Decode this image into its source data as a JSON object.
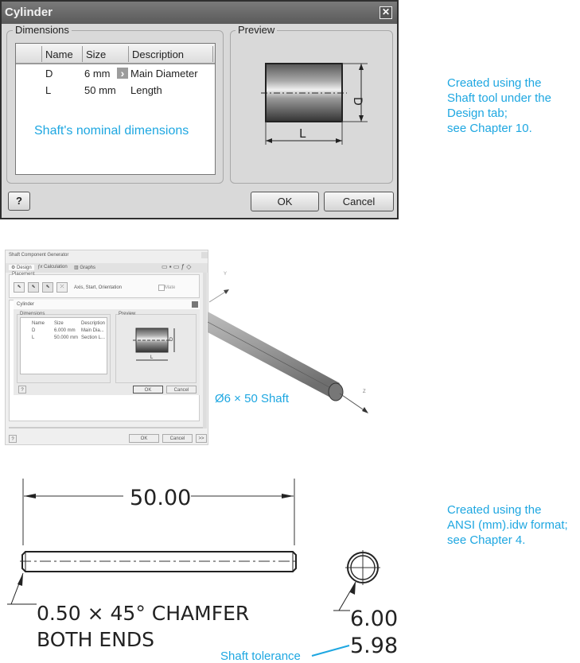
{
  "cylinder_dialog": {
    "title": "Cylinder",
    "close_label": "✕",
    "dimensions_group": "Dimensions",
    "preview_group": "Preview",
    "columns": [
      "Name",
      "Size",
      "Description"
    ],
    "rows": [
      {
        "name": "D",
        "size": "6 mm",
        "description": "Main Diameter",
        "has_arrow": true
      },
      {
        "name": "L",
        "size": "50 mm",
        "description": "Length",
        "has_arrow": false
      }
    ],
    "arrow_glyph": "›",
    "annotation": "Shaft's nominal dimensions",
    "preview_labels": {
      "length": "L",
      "diameter": "D"
    },
    "help_label": "?",
    "ok_label": "OK",
    "cancel_label": "Cancel"
  },
  "callout_top": [
    "Created using the",
    "Shaft tool under the",
    "Design tab;",
    "see Chapter 10."
  ],
  "shaft_generator": {
    "title": "Shaft Component Generator",
    "tabs": [
      "Design",
      "Calculation",
      "Graphs"
    ],
    "placement_label": "Placement",
    "placement_text": "Axis, Start, Orientation",
    "mate_label": "Mate",
    "cylinder_title": "Cylinder",
    "dimensions_group": "Dimensions",
    "preview_group": "Preview",
    "columns": [
      "Name",
      "Size",
      "Description"
    ],
    "rows": [
      {
        "name": "D",
        "size": "6.000 mm",
        "description": "Main Dia..."
      },
      {
        "name": "L",
        "size": "50.000 mm",
        "description": "Section L..."
      }
    ],
    "preview_labels": {
      "length": "L",
      "diameter": "D"
    },
    "inner_ok": "OK",
    "inner_cancel": "Cancel",
    "ok_label": "OK",
    "cancel_label": "Cancel",
    "more_label": ">>",
    "help_label": "?"
  },
  "model_view": {
    "axis_y": "Y",
    "axis_z": "Z",
    "shaft_label": "Ø6 × 50 Shaft"
  },
  "drawing": {
    "length_dim": "50.00",
    "chamfer_note_line1": "0.50 × 45° CHAMFER",
    "chamfer_note_line2": "BOTH ENDS",
    "diameter_upper": "6.00",
    "diameter_lower": "5.98",
    "tolerance_label": "Shaft tolerance"
  },
  "callout_bottom": [
    "Created using the",
    "ANSI (mm).idw format;",
    "see Chapter 4."
  ],
  "colors": {
    "accent": "#1ea7e1",
    "dialog_bg": "#d9d9d9",
    "titlebar": "#666666"
  }
}
